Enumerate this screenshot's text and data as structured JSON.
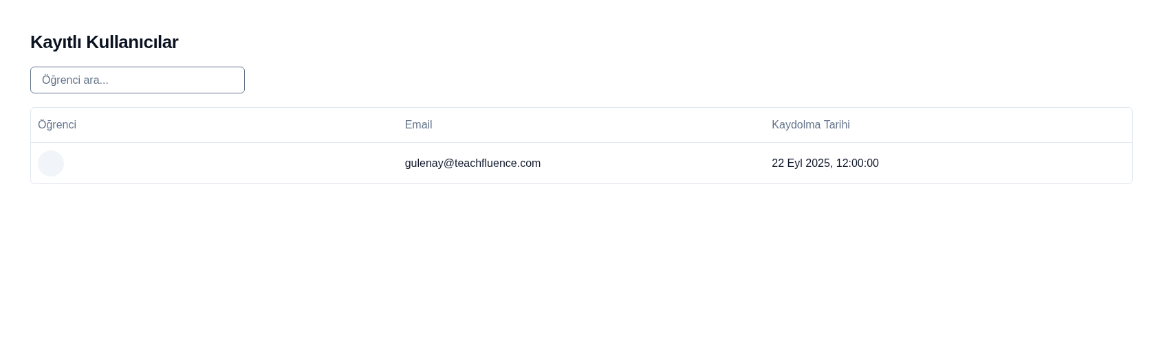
{
  "title": "Kayıtlı Kullanıcılar",
  "search": {
    "placeholder": "Öğrenci ara..."
  },
  "table": {
    "columns": [
      "Öğrenci",
      "Email",
      "Kaydolma Tarihi"
    ],
    "rows": [
      {
        "email": "gulenay@teachfluence.com",
        "date": "22 Eyl 2025, 12:00:00"
      }
    ]
  }
}
